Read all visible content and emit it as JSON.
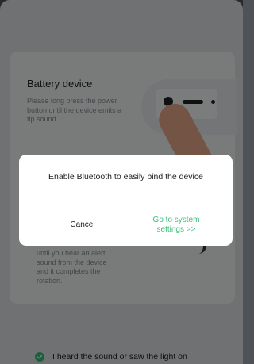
{
  "card": {
    "title": "Battery device",
    "description": "Please long press the power button until the device emits a tip sound.",
    "description_2": "until you hear an alert sound from the device and it completes the rotation."
  },
  "confirm": {
    "label": "I heard the sound or saw the light on",
    "checked": true
  },
  "dialog": {
    "message": "Enable Bluetooth to easily bind the device",
    "cancel_label": "Cancel",
    "settings_label": "Go to system\nsettings >>"
  },
  "colors": {
    "accent": "#3bbf7a",
    "overlay": "rgba(0,0,0,0.5)"
  }
}
